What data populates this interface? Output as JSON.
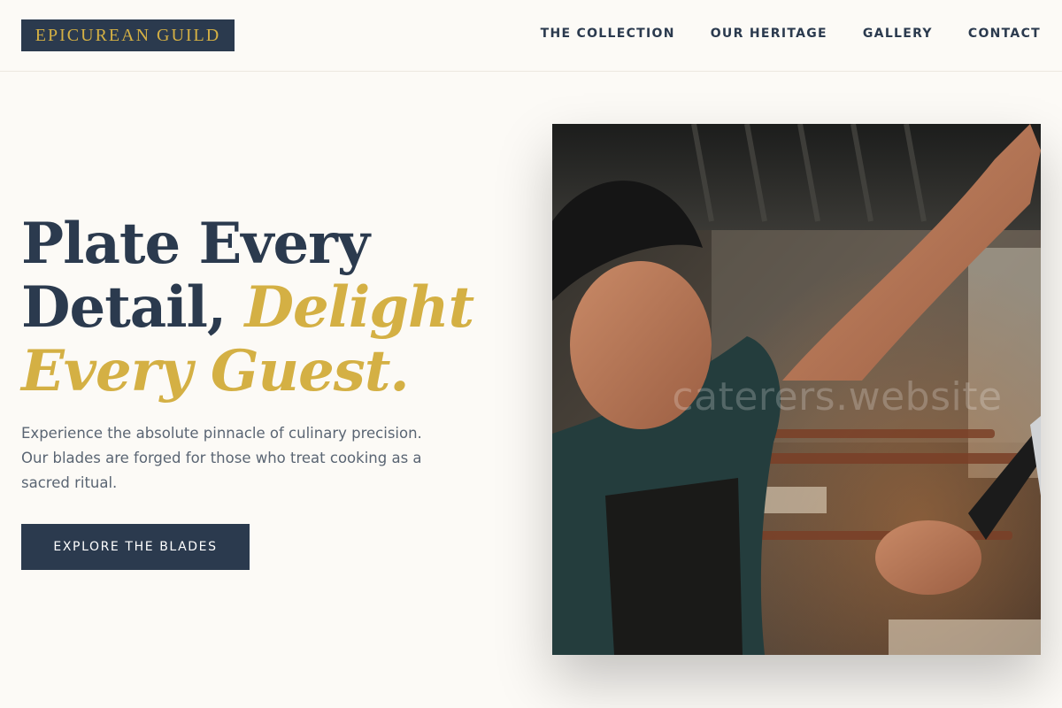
{
  "brand": {
    "logo_text": "EPICUREAN GUILD"
  },
  "nav": {
    "items": [
      {
        "label": "THE COLLECTION"
      },
      {
        "label": "OUR HERITAGE"
      },
      {
        "label": "GALLERY"
      },
      {
        "label": "CONTACT"
      }
    ]
  },
  "hero": {
    "headline": {
      "line1": "Plate Every",
      "line2_plain": "Detail, ",
      "line2_accent": "Delight",
      "line3_accent": "Every Guest."
    },
    "subtext": "Experience the absolute pinnacle of culinary precision. Our blades are forged for those who treat cooking as a sacred ritual.",
    "cta_label": "EXPLORE THE BLADES",
    "image": {
      "subject": "chef-holding-knife-in-kitchen",
      "watermark": "caterers.website"
    }
  },
  "colors": {
    "navy": "#2b3a4e",
    "gold": "#d4b044",
    "background": "#fcfaf6",
    "body_text": "#5a6573"
  }
}
